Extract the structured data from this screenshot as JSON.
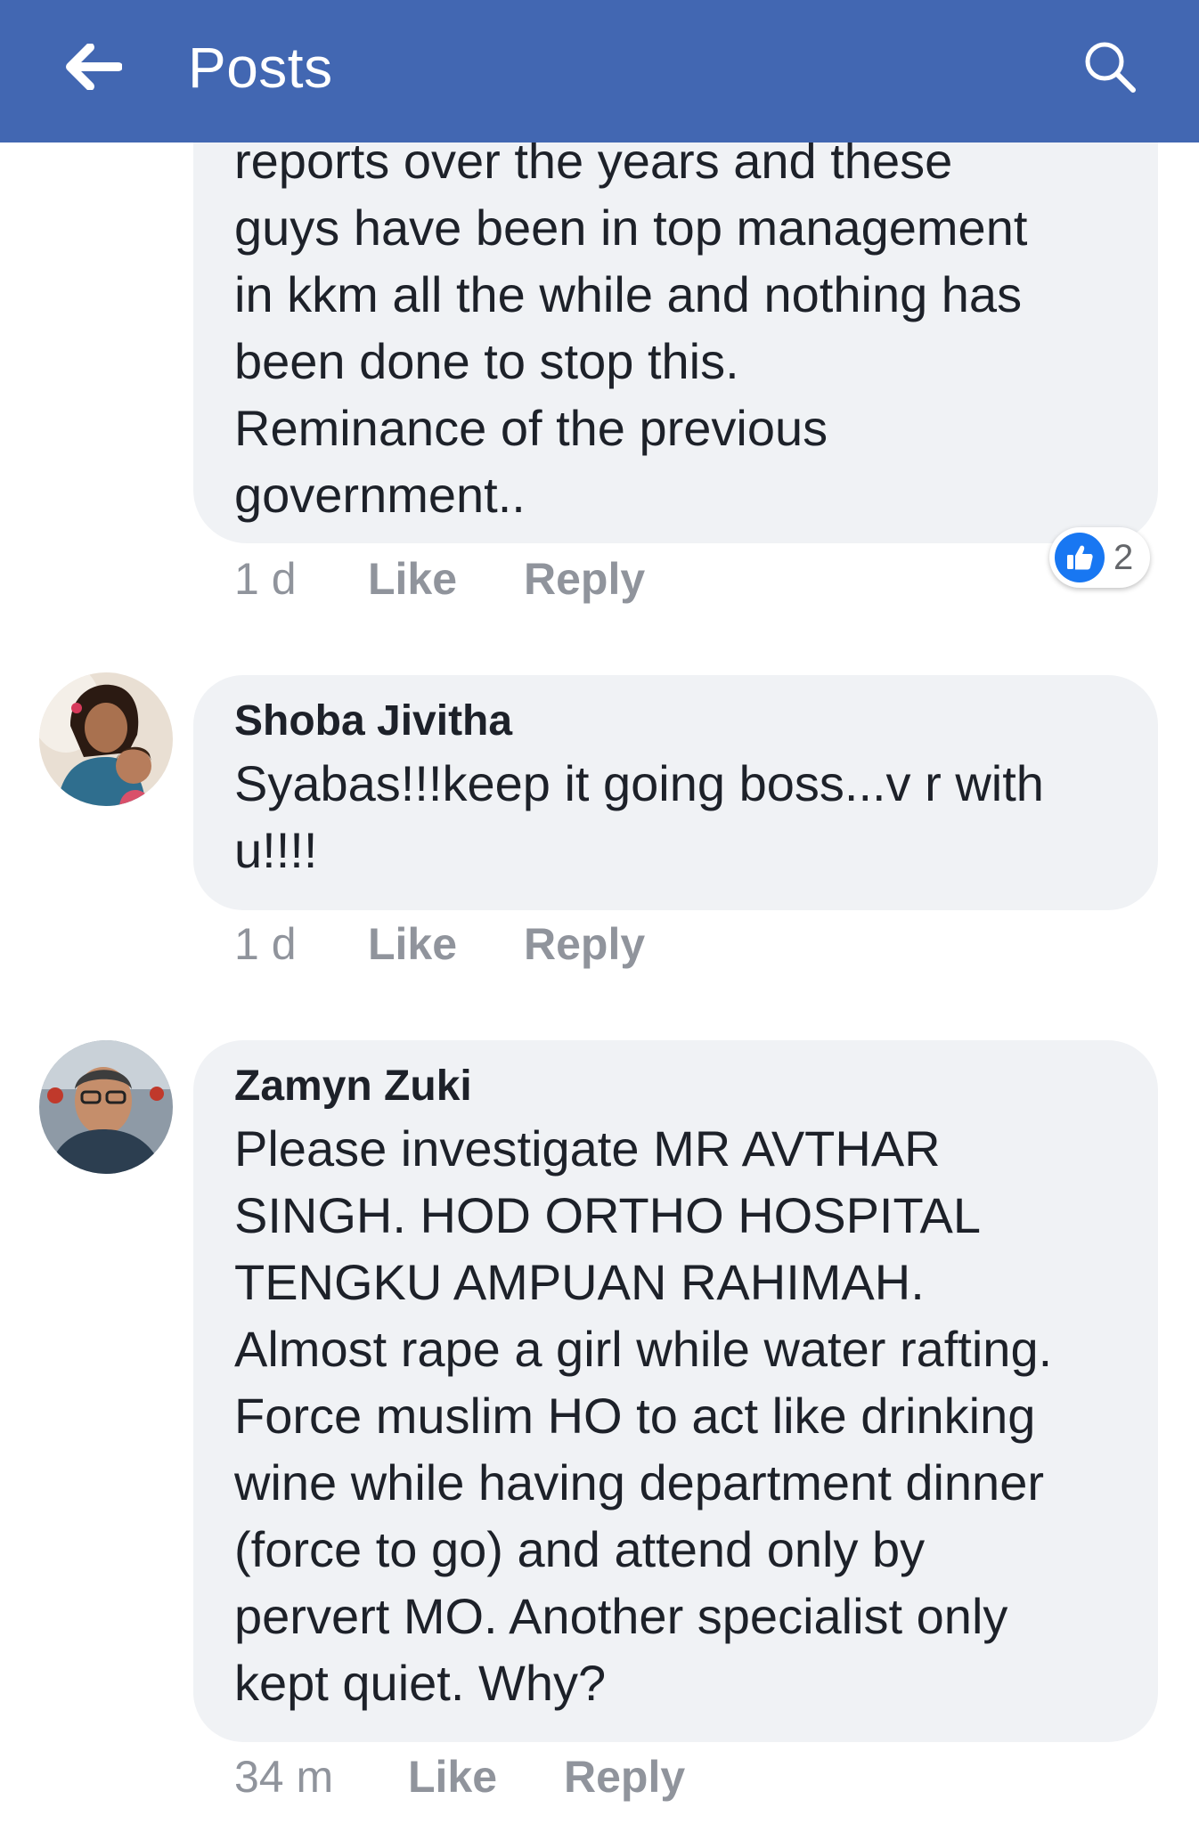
{
  "header": {
    "title": "Posts",
    "back_icon": "arrow-left-icon",
    "search_icon": "search-icon",
    "background": "#4267b2"
  },
  "comments": [
    {
      "text": "reports over the years and these\nguys have been in top management\nin kkm all the while and nothing has\nbeen done to stop this.\nReminance of the previous\ngovernment..",
      "time": "1 d",
      "like": "Like",
      "reply": "Reply",
      "reactions": {
        "icon": "thumbs-up-icon",
        "count": "2"
      }
    },
    {
      "author": "Shoba Jivitha",
      "text": "Syabas!!!keep it going boss...v r with\nu!!!!",
      "time": "1 d",
      "like": "Like",
      "reply": "Reply"
    },
    {
      "author": "Zamyn Zuki",
      "text": "Please investigate MR AVTHAR\nSINGH. HOD ORTHO HOSPITAL\nTENGKU AMPUAN RAHIMAH.\nAlmost rape a girl while water rafting.\nForce muslim HO to act like drinking\nwine while having department dinner\n(force to go) and attend only by\npervert MO. Another specialist only\nkept quiet. Why?",
      "time": "34 m",
      "like": "Like",
      "reply": "Reply"
    }
  ],
  "colors": {
    "bubble": "#f0f2f5",
    "meta": "#90949c",
    "like_badge": "#1877f2"
  }
}
